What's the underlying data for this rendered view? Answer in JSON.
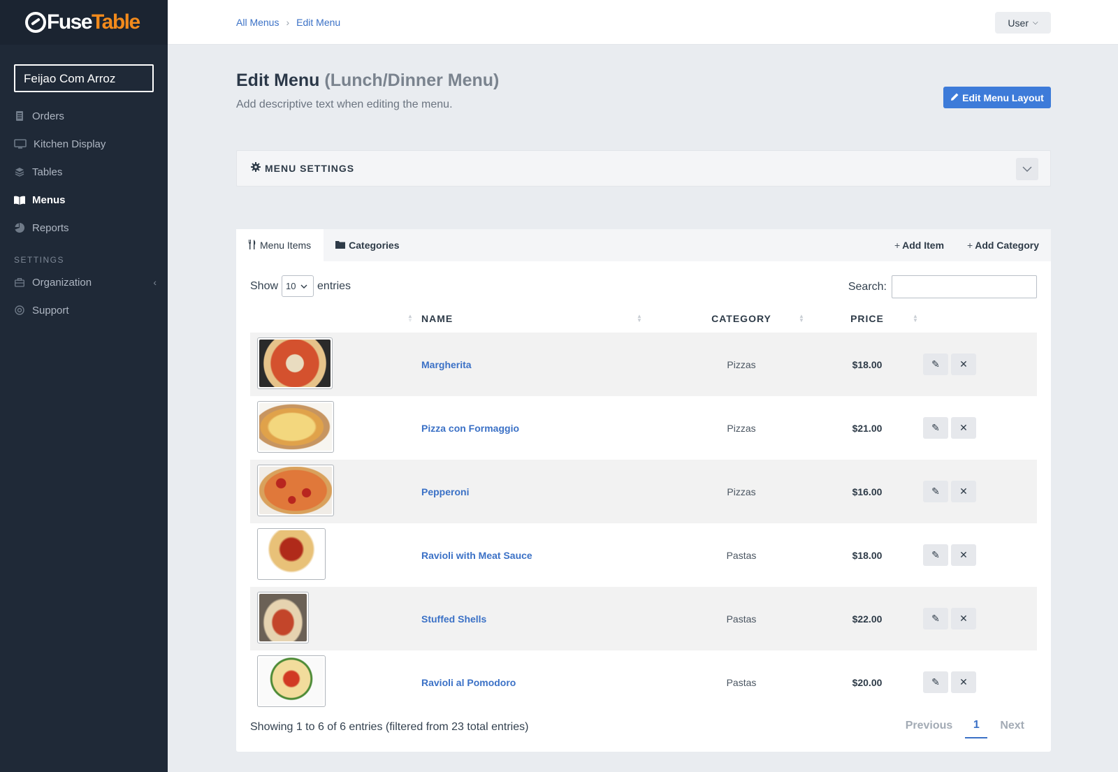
{
  "logo": {
    "part1": "Fuse",
    "part2": "Table"
  },
  "sidebar": {
    "org_name": "Feijao Com Arroz",
    "items": [
      {
        "label": "Orders",
        "icon": "receipt-icon"
      },
      {
        "label": "Kitchen Display",
        "icon": "monitor-icon"
      },
      {
        "label": "Tables",
        "icon": "layers-icon"
      },
      {
        "label": "Menus",
        "icon": "book-icon"
      },
      {
        "label": "Reports",
        "icon": "pie-chart-icon"
      }
    ],
    "section_label": "SETTINGS",
    "settings_items": [
      {
        "label": "Organization",
        "icon": "briefcase-icon"
      },
      {
        "label": "Support",
        "icon": "lifebuoy-icon"
      }
    ]
  },
  "topbar": {
    "breadcrumb": [
      "All Menus",
      "Edit Menu"
    ],
    "user_label": "User"
  },
  "header": {
    "title": "Edit Menu",
    "subtitle": "(Lunch/Dinner Menu)",
    "description": "Add descriptive text when editing the menu.",
    "edit_layout_label": "Edit Menu Layout"
  },
  "settings_bar": {
    "title": "MENU SETTINGS"
  },
  "tabs": {
    "menu_items": "Menu Items",
    "categories": "Categories",
    "add_item": "Add Item",
    "add_category": "Add Category"
  },
  "table_controls": {
    "show_label": "Show",
    "page_size": "10",
    "entries_label": "entries",
    "search_label": "Search:",
    "search_value": ""
  },
  "columns": {
    "name": "NAME",
    "category": "CATEGORY",
    "price": "PRICE"
  },
  "rows": [
    {
      "name": "Margherita",
      "category": "Pizzas",
      "price": "$18.00"
    },
    {
      "name": "Pizza con Formaggio",
      "category": "Pizzas",
      "price": "$21.00"
    },
    {
      "name": "Pepperoni",
      "category": "Pizzas",
      "price": "$16.00"
    },
    {
      "name": "Ravioli with Meat Sauce",
      "category": "Pastas",
      "price": "$18.00"
    },
    {
      "name": "Stuffed Shells",
      "category": "Pastas",
      "price": "$22.00"
    },
    {
      "name": "Ravioli al Pomodoro",
      "category": "Pastas",
      "price": "$20.00"
    }
  ],
  "footer": {
    "info": "Showing 1 to 6 of 6 entries (filtered from 23 total entries)",
    "previous": "Previous",
    "current_page": "1",
    "next": "Next"
  },
  "colors": {
    "sidebar_bg": "#1f2937",
    "accent": "#3d7bd9",
    "link": "#3b71c6",
    "brand_orange": "#f28a1c"
  }
}
